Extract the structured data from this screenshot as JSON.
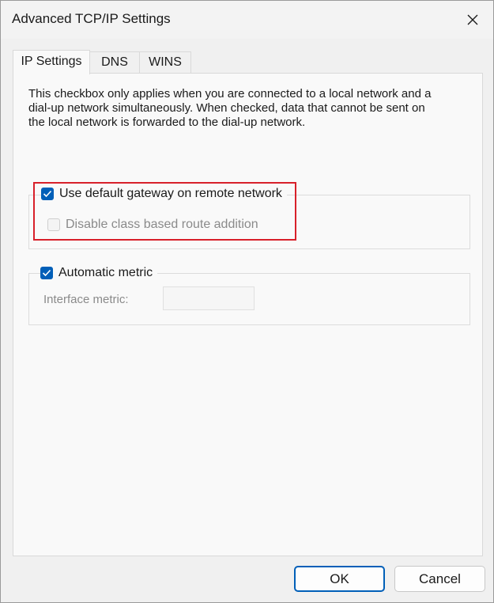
{
  "window": {
    "title": "Advanced TCP/IP Settings"
  },
  "tabs": [
    {
      "label": "IP Settings",
      "active": true
    },
    {
      "label": "DNS",
      "active": false
    },
    {
      "label": "WINS",
      "active": false
    }
  ],
  "description": "This checkbox only applies when you are connected to a local network and a dial-up network simultaneously.  When checked, data that cannot be sent on the local network is forwarded to the dial-up network.",
  "gateway_group": {
    "use_default_gateway": {
      "label": "Use default gateway on remote network",
      "checked": true,
      "enabled": true
    },
    "disable_class_route": {
      "label": "Disable class based route addition",
      "checked": false,
      "enabled": false
    }
  },
  "metric_group": {
    "automatic_metric": {
      "label": "Automatic metric",
      "checked": true,
      "enabled": true
    },
    "interface_metric": {
      "label": "Interface metric:",
      "value": "",
      "enabled": false
    }
  },
  "buttons": {
    "ok": "OK",
    "cancel": "Cancel"
  },
  "colors": {
    "accent": "#005fb8",
    "highlight": "#d8202a"
  }
}
